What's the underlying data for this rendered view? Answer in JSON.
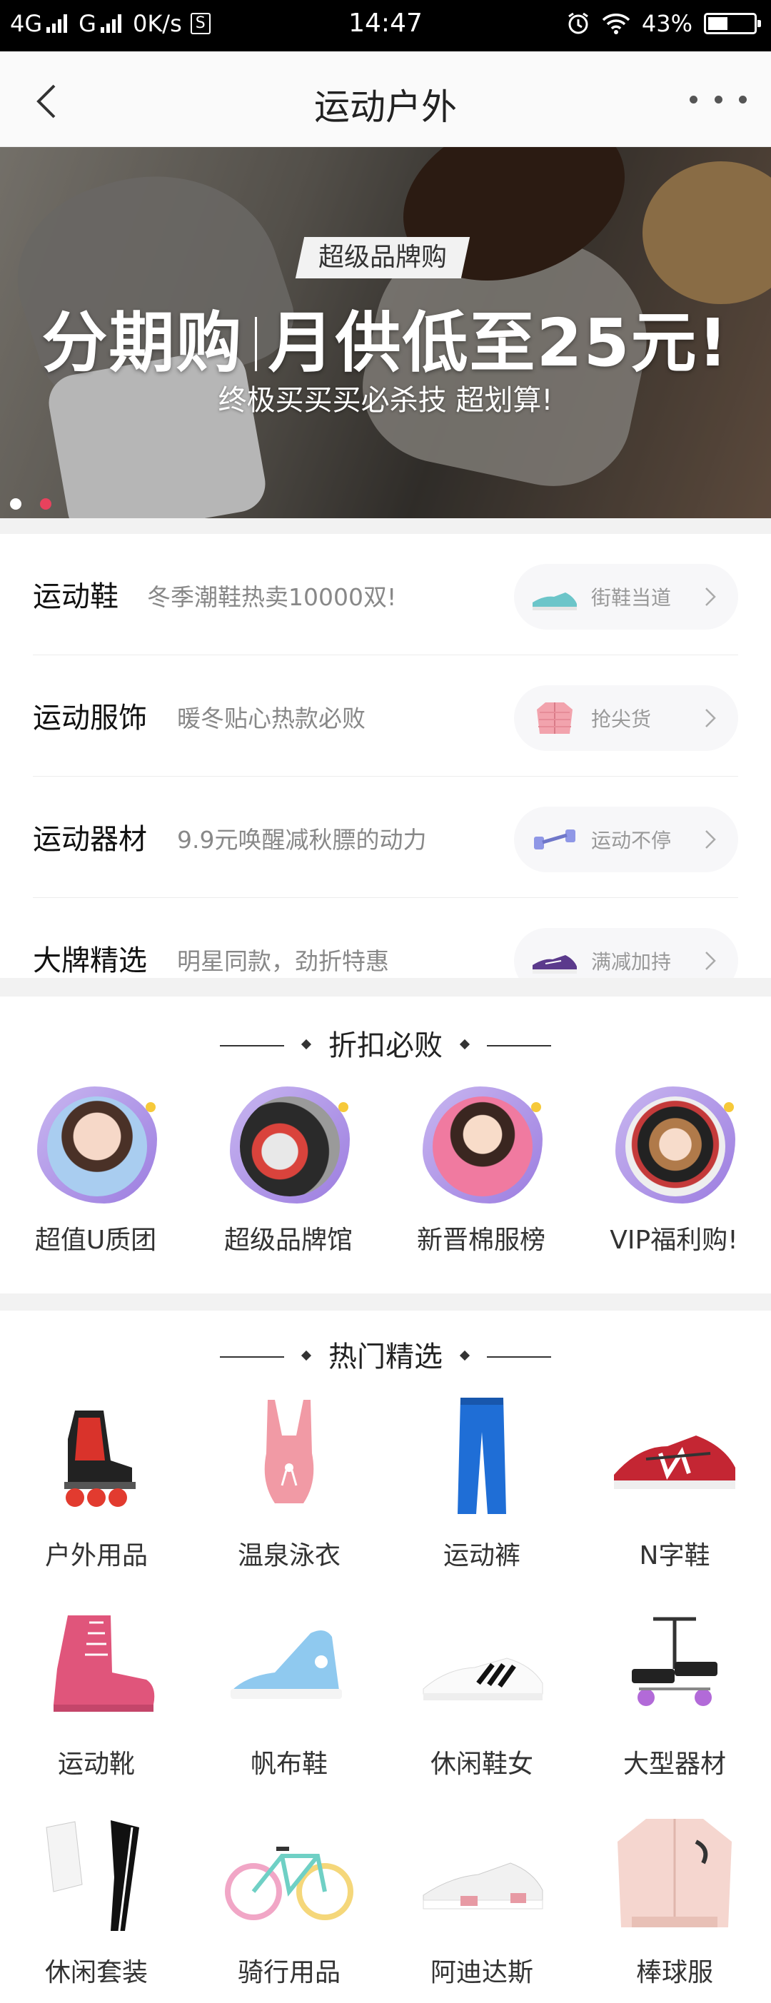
{
  "status_bar": {
    "network1": "4G",
    "network2": "G",
    "speed": "0K/s",
    "sim_badge": "S",
    "time": "14:47",
    "battery": "43%",
    "battery_level": 0.43,
    "icons": [
      "alarm-icon",
      "wifi-icon",
      "battery-icon"
    ]
  },
  "nav": {
    "title": "运动户外",
    "back_icon": "back-arrow-icon",
    "more_icon": "more-dots-icon"
  },
  "banner": {
    "tag": "超级品牌购",
    "headline_left": "分期购",
    "headline_right": "月供低至25元!",
    "subtitle": "终极买买买必杀技 超划算!",
    "slide_count": 2,
    "active_slide": 2
  },
  "categories": [
    {
      "name": "运动鞋",
      "desc": "冬季潮鞋热卖10000双!",
      "pill_label": "街鞋当道",
      "pill_icon": "sneaker-icon"
    },
    {
      "name": "运动服饰",
      "desc": "暖冬贴心热款必败",
      "pill_label": "抢尖货",
      "pill_icon": "jacket-icon"
    },
    {
      "name": "运动器材",
      "desc": "9.9元唤醒减秋膘的动力",
      "pill_label": "运动不停",
      "pill_icon": "dumbbell-icon"
    },
    {
      "name": "大牌精选",
      "desc": "明星同款，劲折特惠",
      "pill_label": "满减加持",
      "pill_icon": "sneaker-purple-icon"
    }
  ],
  "discount_section": {
    "title": "折扣必败",
    "items": [
      {
        "label": "超值U质团",
        "icon": "girl-blue-hood-image"
      },
      {
        "label": "超级品牌馆",
        "icon": "brand-sneakers-image"
      },
      {
        "label": "新晋棉服榜",
        "icon": "girl-pink-coat-image"
      },
      {
        "label": "VIP福利购!",
        "icon": "girl-cap-image"
      }
    ]
  },
  "hot_section": {
    "title": "热门精选",
    "items": [
      {
        "label": "户外用品",
        "icon": "inline-skate-image"
      },
      {
        "label": "温泉泳衣",
        "icon": "swimsuit-image"
      },
      {
        "label": "运动裤",
        "icon": "sweatpants-image"
      },
      {
        "label": "N字鞋",
        "icon": "n-sneaker-image"
      },
      {
        "label": "运动靴",
        "icon": "pink-boot-image"
      },
      {
        "label": "帆布鞋",
        "icon": "canvas-shoe-image"
      },
      {
        "label": "休闲鞋女",
        "icon": "white-sneaker-image"
      },
      {
        "label": "大型器材",
        "icon": "stepper-machine-image"
      },
      {
        "label": "休闲套装",
        "icon": "tracksuit-image"
      },
      {
        "label": "骑行用品",
        "icon": "bicycle-image"
      },
      {
        "label": "阿迪达斯",
        "icon": "adidas-shoe-image"
      },
      {
        "label": "棒球服",
        "icon": "baseball-jacket-image"
      }
    ]
  }
}
